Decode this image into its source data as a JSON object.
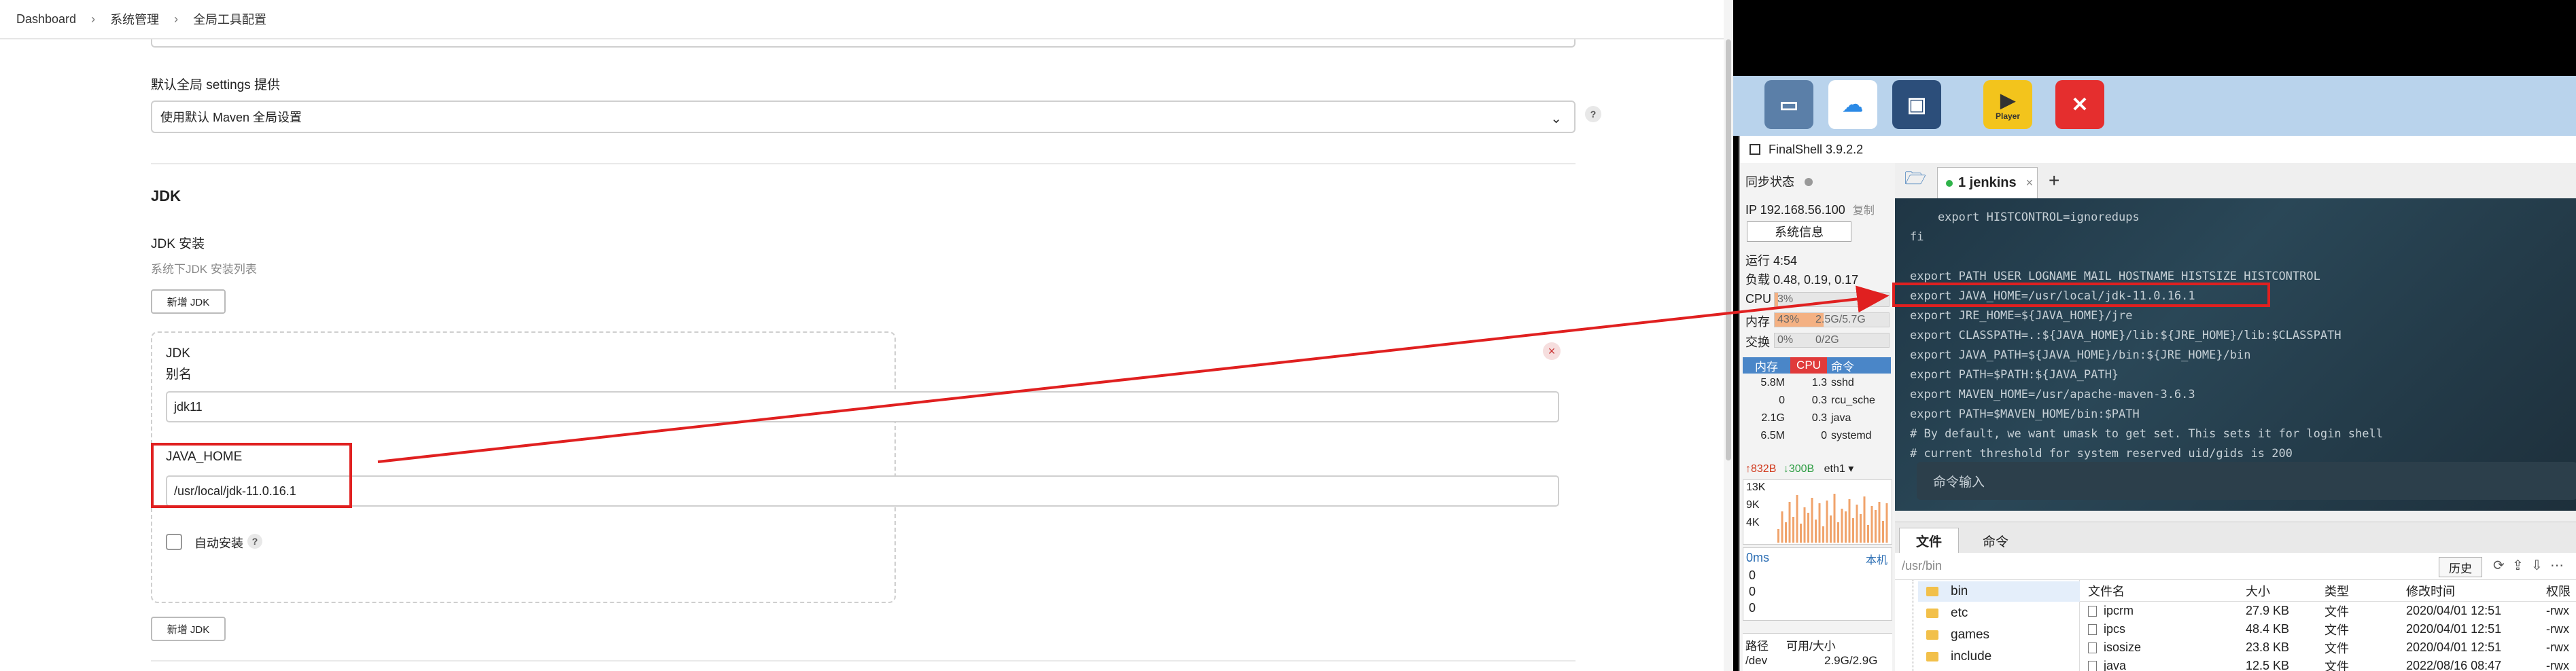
{
  "breadcrumb": [
    "Dashboard",
    "系统管理",
    "全局工具配置"
  ],
  "maven": {
    "label": "默认全局 settings 提供",
    "value": "使用默认 Maven 全局设置",
    "help": "?"
  },
  "jdk": {
    "section_title": "JDK",
    "install_label": "JDK 安装",
    "install_desc": "系统下JDK 安装列表",
    "add_button": "新增 JDK",
    "card_title": "JDK",
    "alias_label": "别名",
    "alias_value": "jdk11",
    "java_home_label": "JAVA_HOME",
    "java_home_value": "/usr/local/jdk-11.0.16.1",
    "auto_install_label": "自动安装",
    "help": "?",
    "close": "×",
    "add_button_bottom": "新增 JDK"
  },
  "taskbar": {
    "apps": [
      "computer-icon",
      "baidu-netdisk-icon",
      "remote-desktop-icon",
      "potplayer-icon",
      "xmind-icon"
    ],
    "player_label": "Player"
  },
  "finalshell": {
    "title": "FinalShell 3.9.2.2",
    "sync_status": "同步状态",
    "ip": "IP 192.168.56.100",
    "copy": "复制",
    "sysinfo_button": "系统信息",
    "uptime": "运行 4:54",
    "load": "负载 0.48, 0.19, 0.17",
    "cpu_label": "CPU",
    "cpu_value": "3%",
    "cpu_pct": 0.03,
    "mem_label": "内存",
    "mem_pct_text": "43%",
    "mem_pct": 0.43,
    "mem_value": "2.5G/5.7G",
    "swap_label": "交换",
    "swap_pct_text": "0%",
    "swap_value": "0/2G",
    "proc_headers": [
      "内存",
      "CPU",
      "命令"
    ],
    "processes": [
      {
        "mem": "5.8M",
        "cpu": "1.3",
        "cmd": "sshd"
      },
      {
        "mem": "0",
        "cpu": "0.3",
        "cmd": "rcu_sche"
      },
      {
        "mem": "2.1G",
        "cpu": "0.3",
        "cmd": "java"
      },
      {
        "mem": "6.5M",
        "cpu": "0",
        "cmd": "systemd"
      }
    ],
    "net_up": "↑832B",
    "net_down": "↓300B",
    "net_iface": "eth1",
    "net_scale": [
      "13K",
      "9K",
      "4K"
    ],
    "ping_label": "0ms",
    "ping_host": "本机",
    "ping_values": [
      "0",
      "0",
      "0"
    ],
    "disk_headers": [
      "路径",
      "可用/大小"
    ],
    "disk_row": {
      "path": "/dev",
      "size": "2.9G/2.9G"
    },
    "tab_label": "1 jenkins",
    "tab_close": "×",
    "tab_add": "+",
    "terminal_lines": [
      "    export HISTCONTROL=ignoredups",
      "fi",
      "",
      "export PATH USER LOGNAME MAIL HOSTNAME HISTSIZE HISTCONTROL",
      "export JAVA_HOME=/usr/local/jdk-11.0.16.1",
      "export JRE_HOME=${JAVA_HOME}/jre",
      "export CLASSPATH=.:${JAVA_HOME}/lib:${JRE_HOME}/lib:$CLASSPATH",
      "export JAVA_PATH=${JAVA_HOME}/bin:${JRE_HOME}/bin",
      "export PATH=$PATH:${JAVA_PATH}",
      "export MAVEN_HOME=/usr/apache-maven-3.6.3",
      "export PATH=$MAVEN_HOME/bin:$PATH",
      "# By default, we want umask to get set. This sets it for login shell",
      "# current threshold for system reserved uid/gids is 200"
    ],
    "command_input": "命令输入",
    "bottom_tabs": [
      "文件",
      "命令"
    ],
    "path": "/usr/bin",
    "history_button": "历史",
    "tree": [
      "bin",
      "etc",
      "games",
      "include"
    ],
    "file_headers": [
      "文件名",
      "大小",
      "类型",
      "修改时间",
      "权限"
    ],
    "files": [
      {
        "name": "ipcrm",
        "size": "27.9 KB",
        "type": "文件",
        "mtime": "2020/04/01 12:51",
        "perm": "-rwx"
      },
      {
        "name": "ipcs",
        "size": "48.4 KB",
        "type": "文件",
        "mtime": "2020/04/01 12:51",
        "perm": "-rwx"
      },
      {
        "name": "isosize",
        "size": "23.8 KB",
        "type": "文件",
        "mtime": "2020/04/01 12:51",
        "perm": "-rwx"
      },
      {
        "name": "java",
        "size": "12.5 KB",
        "type": "文件",
        "mtime": "2022/08/16 08:47",
        "perm": "-rwx"
      }
    ]
  },
  "colors": {
    "annotation": "#e02020",
    "accent": "#4a86c8",
    "terminal_bg": "#2a4757"
  }
}
